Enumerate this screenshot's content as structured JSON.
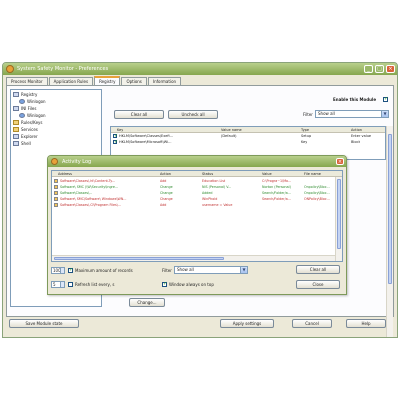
{
  "window": {
    "title": "System Safety Monitor - Preferences",
    "min_glyph": "_",
    "max_glyph": "□",
    "close_glyph": "×"
  },
  "tabs": [
    {
      "label": "Process Monitor"
    },
    {
      "label": "Application Rules"
    },
    {
      "label": "Registry"
    },
    {
      "label": "Options"
    },
    {
      "label": "Information"
    }
  ],
  "tree": [
    {
      "label": "Registry"
    },
    {
      "label": "Winlogon"
    },
    {
      "label": "INI Files"
    },
    {
      "label": "Winlogon"
    },
    {
      "label": "Rules/Keys"
    },
    {
      "label": "Services"
    },
    {
      "label": "Explorer"
    },
    {
      "label": "Shell"
    }
  ],
  "registry": {
    "clear_all_label": "Clear all",
    "uncheck_all_label": "Uncheck all",
    "enable_label": "Enable this Module",
    "filter_label": "Filter",
    "filter_value": "Show all",
    "grid_headers": [
      "Key",
      "Value name",
      "Type",
      "Action"
    ],
    "grid_rows": [
      [
        "HKLM\\Software\\Classes\\Exefi...",
        "(Default)",
        "Setup",
        "Enter value"
      ],
      [
        "HKLM\\Software\\Microsoft\\Wi...",
        "",
        "Key",
        "Block"
      ]
    ],
    "change_label": "Change..."
  },
  "log": {
    "title": "Activity Log",
    "headers": [
      "Address",
      "Action",
      "Status",
      "Value",
      "File name"
    ],
    "rows": [
      {
        "address": "Software\\Classes\\.ht\\Content-Ty...",
        "action": "Add",
        "status": "Education List",
        "value": "C:\\Progra~1\\Mo...",
        "file": "",
        "color": "#c03030"
      },
      {
        "address": "Software\\ SMC (\\W\\Security\\Ingre...",
        "action": "Change",
        "status": "NIS (Personal) V...",
        "value": "Norton (Personal)",
        "file": "Onpolicy\\Bloc...",
        "color": "#2e8b2e"
      },
      {
        "address": "Software\\Classes\\...",
        "action": "Change",
        "status": "Added",
        "value": "Search/Folder/a...",
        "file": "Onpolicy\\Bloc...",
        "color": "#2e8b2e"
      },
      {
        "address": "Software\\ SMC\\Software\\ Windows\\WN...",
        "action": "Change",
        "status": "WinPhold",
        "value": "Search/Folder/a...",
        "file": "ONPolicy\\Bloc...",
        "color": "#c03030"
      },
      {
        "address": "Software\\Classes\\.Cl\\Program Files\\...",
        "action": "Add",
        "status": "username = Value",
        "value": "",
        "file": "",
        "color": "#c03030"
      }
    ],
    "max_label": "Maximum amount of records",
    "max_value": "100",
    "filter_label": "Filter",
    "filter_value": "Show all",
    "interval_value": "5",
    "interval_label": "Refresh list every, s",
    "always_top_label": "Window always on top",
    "clear_label": "Clear all",
    "close_label": "Close"
  },
  "footer": {
    "save_module_label": "Save Module state",
    "apply_label": "Apply settings",
    "cancel_label": "Cancel",
    "help_label": "Help"
  }
}
